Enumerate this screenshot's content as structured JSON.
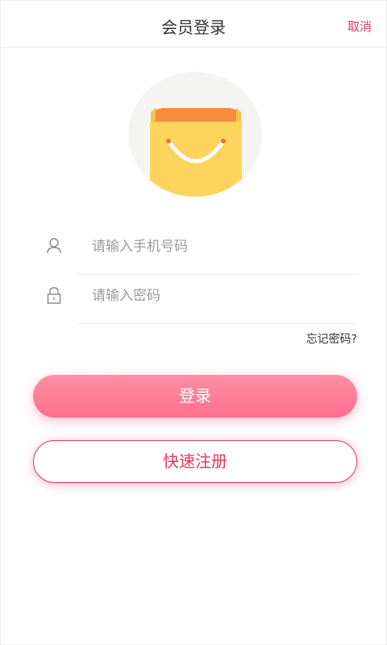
{
  "header": {
    "title": "会员登录",
    "cancel_label": "取消"
  },
  "logo": {
    "icon": "shopping-bag-icon",
    "bag_color": "#fcd45c",
    "bag_top_color": "#f78c3b",
    "circle_color": "#f4f4f2"
  },
  "form": {
    "phone": {
      "icon": "user-icon",
      "placeholder": "请输入手机号码",
      "value": ""
    },
    "password": {
      "icon": "lock-icon",
      "placeholder": "请输入密码",
      "value": ""
    },
    "forgot_label": "忘记密码?"
  },
  "actions": {
    "login_label": "登录",
    "register_label": "快速注册"
  },
  "colors": {
    "accent": "#e5385b",
    "login_gradient_top": "#ff8fa5",
    "login_gradient_bottom": "#ff6f8d"
  }
}
